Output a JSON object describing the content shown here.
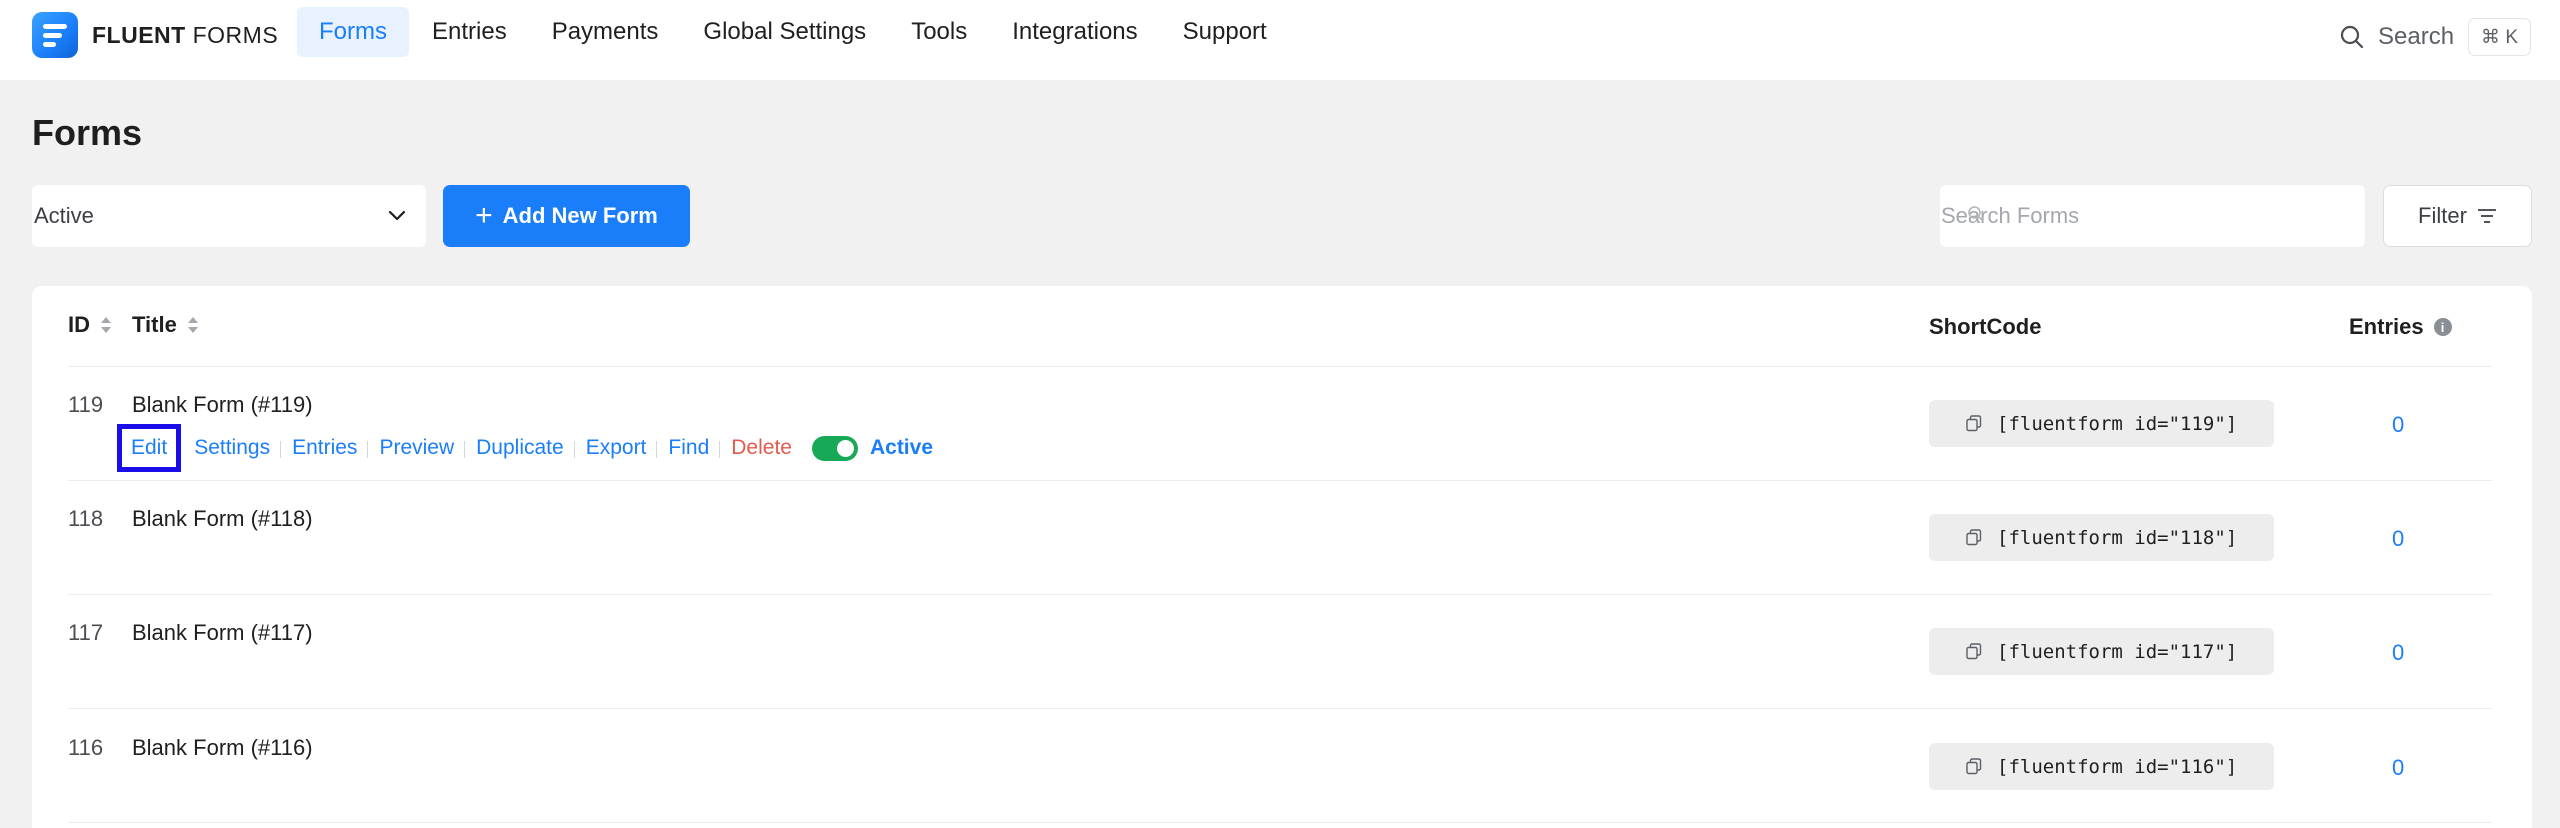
{
  "brand": {
    "name_bold": "FLUENT",
    "name_light": "FORMS"
  },
  "nav": [
    {
      "label": "Forms",
      "active": true
    },
    {
      "label": "Entries",
      "active": false
    },
    {
      "label": "Payments",
      "active": false
    },
    {
      "label": "Global Settings",
      "active": false
    },
    {
      "label": "Tools",
      "active": false
    },
    {
      "label": "Integrations",
      "active": false
    },
    {
      "label": "Support",
      "active": false
    }
  ],
  "top_search": {
    "label": "Search",
    "shortcut": "⌘ K"
  },
  "page": {
    "title": "Forms"
  },
  "toolbar": {
    "status_filter": "Active",
    "add_button": "Add New Form",
    "search_placeholder": "Search Forms",
    "filter_button": "Filter"
  },
  "table": {
    "columns": {
      "id": "ID",
      "title": "Title",
      "shortcode": "ShortCode",
      "entries": "Entries"
    },
    "row_actions": {
      "edit": "Edit",
      "settings": "Settings",
      "entries": "Entries",
      "preview": "Preview",
      "duplicate": "Duplicate",
      "export": "Export",
      "find": "Find",
      "delete": "Delete",
      "status": "Active"
    },
    "rows": [
      {
        "id": "119",
        "title": "Blank Form (#119)",
        "shortcode": "[fluentform id=\"119\"]",
        "entries": "0"
      },
      {
        "id": "118",
        "title": "Blank Form (#118)",
        "shortcode": "[fluentform id=\"118\"]",
        "entries": "0"
      },
      {
        "id": "117",
        "title": "Blank Form (#117)",
        "shortcode": "[fluentform id=\"117\"]",
        "entries": "0"
      },
      {
        "id": "116",
        "title": "Blank Form (#116)",
        "shortcode": "[fluentform id=\"116\"]",
        "entries": "0"
      }
    ]
  },
  "colors": {
    "accent": "#1a7efb",
    "danger": "#e35a4e",
    "toggle_on": "#18a957",
    "highlight_box": "#1a0ee8"
  }
}
